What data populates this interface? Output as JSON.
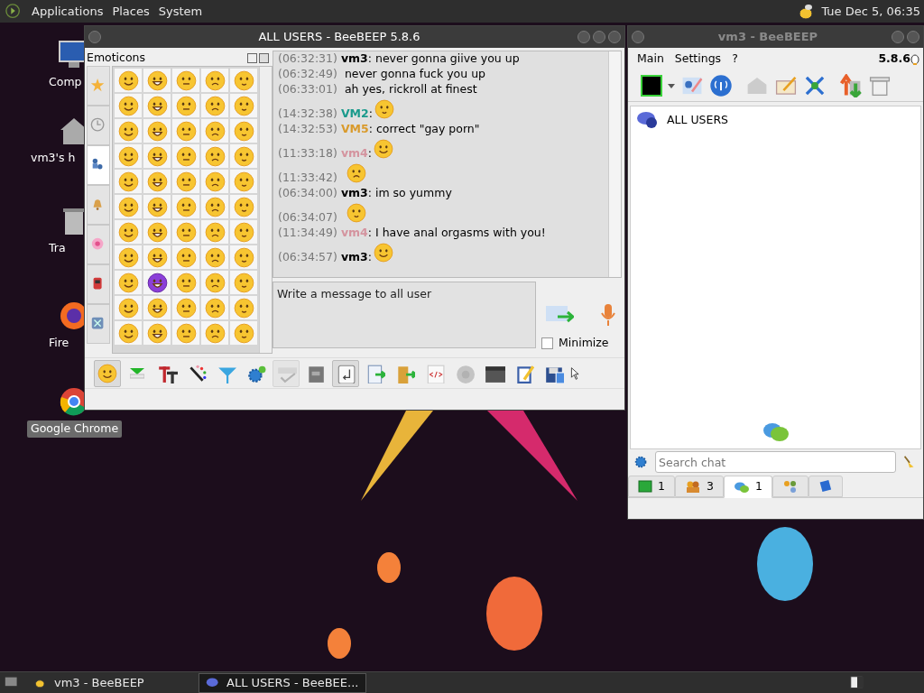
{
  "top_panel": {
    "menus": [
      "Applications",
      "Places",
      "System"
    ],
    "clock": "Tue Dec 5, 06:35"
  },
  "desktop_icons": [
    {
      "label": "Comp",
      "selected": false
    },
    {
      "label": "vm3's h",
      "selected": false
    },
    {
      "label": "Tra",
      "selected": false
    },
    {
      "label": "Fire",
      "selected": false
    },
    {
      "label": "Google Chrome",
      "selected": true
    }
  ],
  "chat_window": {
    "title": "ALL USERS - BeeBEEP 5.8.6",
    "emoticons": {
      "title": "Emoticons",
      "categories": [
        {
          "selected": false
        },
        {
          "selected": false
        },
        {
          "selected": true
        },
        {
          "selected": false
        },
        {
          "selected": false
        },
        {
          "selected": false
        },
        {
          "selected": false
        }
      ]
    },
    "messages": [
      {
        "kind": "text",
        "time": "(06:32:31)",
        "sender": "vm3",
        "color": "#000000",
        "text": ": never gonna giive you up"
      },
      {
        "kind": "text",
        "time": "(06:32:49)",
        "text": "never gonna fuck you up"
      },
      {
        "kind": "text",
        "time": "(06:33:01)",
        "text": "ah yes, rickroll at finest"
      },
      {
        "kind": "emoji",
        "time": "(14:32:38)",
        "sender": "VM2",
        "color": "#1a9a8c",
        "text": ":"
      },
      {
        "kind": "text",
        "time": "(14:32:53)",
        "sender": "VM5",
        "color": "#d99a2b",
        "text": ": correct \"gay porn\""
      },
      {
        "kind": "emoji",
        "time": "(11:33:18)",
        "sender": "vm4",
        "color": "#d4949f",
        "text": ":"
      },
      {
        "kind": "emoji",
        "time": "(11:33:42)"
      },
      {
        "kind": "text",
        "time": "(06:34:00)",
        "sender": "vm3",
        "color": "#000000",
        "text": ": im so yummy"
      },
      {
        "kind": "emoji",
        "time": "(06:34:07)"
      },
      {
        "kind": "text",
        "time": "(11:34:49)",
        "sender": "vm4",
        "color": "#d4949f",
        "text": ": I have anal orgasms with you!"
      },
      {
        "kind": "emoji",
        "time": "(06:34:57)",
        "sender": "vm3",
        "color": "#000000",
        "text": ":"
      }
    ],
    "input": {
      "placeholder": "Write a message to all user"
    },
    "minimize": {
      "label": "Minimize",
      "checked": false
    },
    "toolbar": [
      {
        "selected": true,
        "disabled": false
      },
      {
        "selected": false,
        "disabled": false
      },
      {
        "selected": false,
        "disabled": false
      },
      {
        "selected": false,
        "disabled": false
      },
      {
        "selected": false,
        "disabled": false
      },
      {
        "selected": false,
        "disabled": false
      },
      {
        "selected": true,
        "disabled": true
      },
      {
        "selected": false,
        "disabled": false
      },
      {
        "selected": true,
        "disabled": false
      },
      {
        "selected": false,
        "disabled": false
      },
      {
        "selected": false,
        "disabled": false
      },
      {
        "selected": false,
        "disabled": false
      },
      {
        "selected": false,
        "disabled": true
      },
      {
        "selected": false,
        "disabled": false
      },
      {
        "selected": false,
        "disabled": false
      },
      {
        "selected": false,
        "disabled": false
      }
    ]
  },
  "main_window": {
    "title": "vm3 - BeeBEEP",
    "menus": [
      "Main",
      "Settings",
      "?"
    ],
    "version": "5.8.6",
    "chats": [
      {
        "label": "ALL USERS"
      }
    ],
    "search": {
      "placeholder": "Search chat"
    },
    "tabs": [
      {
        "label": "1",
        "selected": false
      },
      {
        "label": "3",
        "selected": false
      },
      {
        "label": "1",
        "selected": true
      },
      {
        "selected": false
      },
      {
        "selected": false
      }
    ]
  },
  "taskbar": [
    {
      "label": "vm3 - BeeBEEP",
      "selected": false
    },
    {
      "label": "ALL USERS - BeeBEE...",
      "selected": true
    }
  ]
}
